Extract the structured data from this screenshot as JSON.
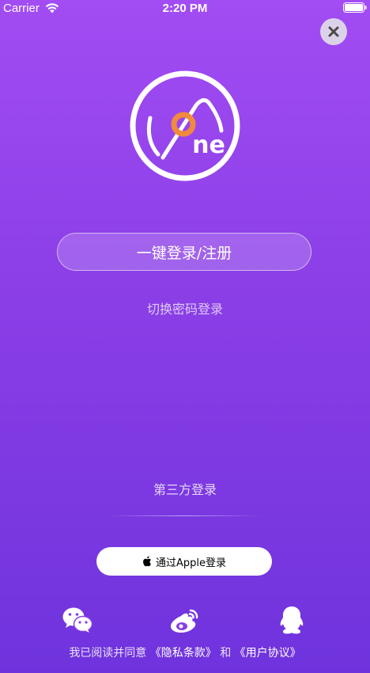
{
  "status_bar": {
    "carrier": "Carrier",
    "time": "2:20 PM",
    "wifi_icon": "wifi-icon",
    "battery_icon": "battery-icon"
  },
  "header": {
    "close_icon": "close-icon"
  },
  "logo": {
    "text": "ne",
    "accent_color": "#f08a3c"
  },
  "login": {
    "one_key_label": "一键登录/注册",
    "switch_password_label": "切换密码登录"
  },
  "third_party": {
    "title": "第三方登录",
    "apple_label": "通过Apple登录",
    "icons": [
      "wechat-icon",
      "weibo-icon",
      "qq-icon"
    ]
  },
  "agreement": {
    "prefix": "我已阅读并同意",
    "privacy": "《隐私条款》",
    "conjunction": "和",
    "terms": "《用户协议》"
  },
  "colors": {
    "gradient_top": "#a24cf3",
    "gradient_bottom": "#6f33dd",
    "apple_button_bg": "#ffffff"
  }
}
